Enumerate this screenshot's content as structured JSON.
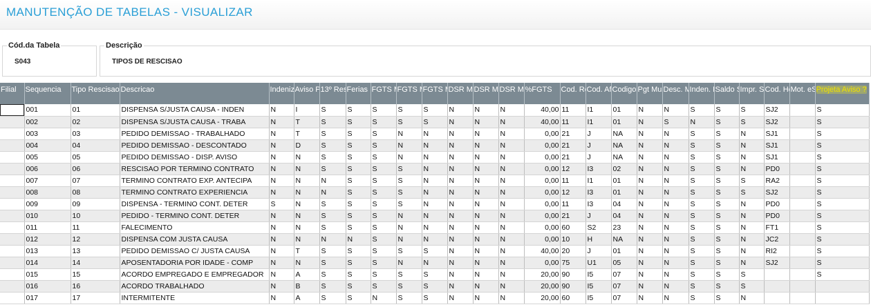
{
  "page": {
    "title": "MANUTENÇÃO DE TABELAS - VISUALIZAR"
  },
  "form": {
    "code_label": "Cód.da Tabela",
    "code_value": "S043",
    "desc_label": "Descrição",
    "desc_value": "TIPOS DE RESCISAO"
  },
  "grid": {
    "highlight_color": "#f0e000",
    "header_bg": "#7c8a93",
    "columns": [
      "Filial",
      "Sequencia",
      "Tipo Rescisao",
      "Descricao",
      "Indenizacao",
      "Aviso P",
      "13º Res",
      "Ferias",
      "FGTS M",
      "FGTS M",
      "FGTS M",
      "DSR Me",
      "DSR Me",
      "DSR Me",
      "%FGTS",
      "Cod. Re",
      "Cod. Af",
      "Codigo",
      "Pgt Mul",
      "Desc. M",
      "Inden. E",
      "Saldo S",
      "Impr. Sa",
      "Cod. Ho",
      "Mot. eS",
      "Projeta Aviso ?"
    ],
    "rows": [
      [
        "",
        "001",
        "01",
        "DISPENSA S/JUSTA CAUSA - INDEN",
        "N",
        "I",
        "S",
        "S",
        "S",
        "S",
        "S",
        "N",
        "N",
        "N",
        "40,00",
        "11",
        "I1",
        "01",
        "N",
        "N",
        "S",
        "S",
        "S",
        "SJ2",
        "",
        "S"
      ],
      [
        "",
        "002",
        "02",
        "DISPENSA S/JUSTA CAUSA - TRABA",
        "N",
        "T",
        "S",
        "S",
        "S",
        "S",
        "S",
        "N",
        "N",
        "N",
        "40,00",
        "11",
        "I1",
        "01",
        "N",
        "S",
        "N",
        "S",
        "S",
        "SJ2",
        "",
        "S"
      ],
      [
        "",
        "003",
        "03",
        "PEDIDO DEMISSAO - TRABALHADO",
        "N",
        "T",
        "S",
        "S",
        "S",
        "N",
        "N",
        "N",
        "N",
        "N",
        "0,00",
        "21",
        "J",
        "NA",
        "N",
        "N",
        "S",
        "S",
        "N",
        "SJ1",
        "",
        "S"
      ],
      [
        "",
        "004",
        "04",
        "PEDIDO DEMISSAO - DESCONTADO",
        "N",
        "D",
        "S",
        "S",
        "S",
        "N",
        "N",
        "N",
        "N",
        "N",
        "0,00",
        "21",
        "J",
        "NA",
        "N",
        "N",
        "S",
        "S",
        "N",
        "SJ1",
        "",
        "S"
      ],
      [
        "",
        "005",
        "05",
        "PEDIDO DEMISSAO - DISP. AVISO",
        "N",
        "N",
        "S",
        "S",
        "S",
        "N",
        "N",
        "N",
        "N",
        "N",
        "0,00",
        "21",
        "J",
        "NA",
        "N",
        "N",
        "S",
        "S",
        "N",
        "SJ1",
        "",
        "S"
      ],
      [
        "",
        "006",
        "06",
        "RESCISAO POR TERMINO CONTRATO",
        "N",
        "N",
        "S",
        "S",
        "S",
        "S",
        "N",
        "N",
        "N",
        "N",
        "0,00",
        "12",
        "I3",
        "02",
        "N",
        "N",
        "S",
        "S",
        "N",
        "PD0",
        "",
        "S"
      ],
      [
        "",
        "007",
        "07",
        "TERMINO CONTRATO EXP. ANTECIPA",
        "N",
        "N",
        "N",
        "S",
        "S",
        "S",
        "N",
        "N",
        "N",
        "N",
        "0,00",
        "11",
        "I1",
        "01",
        "N",
        "N",
        "S",
        "S",
        "S",
        "RA2",
        "",
        "S"
      ],
      [
        "",
        "008",
        "08",
        "TERMINO CONTRATO EXPERIENCIA",
        "N",
        "N",
        "N",
        "S",
        "S",
        "S",
        "N",
        "N",
        "N",
        "N",
        "0,00",
        "12",
        "I3",
        "01",
        "N",
        "N",
        "S",
        "S",
        "S",
        "SJ2",
        "",
        "S"
      ],
      [
        "",
        "009",
        "09",
        "DISPENSA - TERMINO CONT. DETER",
        "S",
        "N",
        "S",
        "S",
        "S",
        "S",
        "N",
        "N",
        "N",
        "N",
        "0,00",
        "11",
        "I3",
        "04",
        "N",
        "N",
        "S",
        "S",
        "N",
        "PD0",
        "",
        "S"
      ],
      [
        "",
        "010",
        "10",
        "PEDIDO - TERMINO CONT. DETER",
        "N",
        "N",
        "S",
        "S",
        "S",
        "N",
        "N",
        "N",
        "N",
        "N",
        "0,00",
        "21",
        "J",
        "04",
        "N",
        "N",
        "S",
        "S",
        "N",
        "PD0",
        "",
        "S"
      ],
      [
        "",
        "011",
        "11",
        "FALECIMENTO",
        "N",
        "N",
        "S",
        "S",
        "S",
        "N",
        "N",
        "N",
        "N",
        "N",
        "0,00",
        "60",
        "S2",
        "23",
        "N",
        "N",
        "S",
        "S",
        "N",
        "FT1",
        "",
        "S"
      ],
      [
        "",
        "012",
        "12",
        "DISPENSA COM JUSTA CAUSA",
        "N",
        "N",
        "N",
        "N",
        "S",
        "N",
        "N",
        "N",
        "N",
        "N",
        "0,00",
        "10",
        "H",
        "NA",
        "N",
        "N",
        "S",
        "S",
        "N",
        "JC2",
        "",
        "S"
      ],
      [
        "",
        "013",
        "13",
        "PEDIDO DEMISSAO C/ JUSTA CAUSA",
        "N",
        "T",
        "S",
        "S",
        "S",
        "S",
        "S",
        "N",
        "N",
        "N",
        "40,00",
        "20",
        "J",
        "01",
        "N",
        "N",
        "S",
        "S",
        "N",
        "RI2",
        "",
        "S"
      ],
      [
        "",
        "014",
        "14",
        "APOSENTADORIA POR IDADE - COMP",
        "N",
        "N",
        "S",
        "S",
        "S",
        "N",
        "N",
        "N",
        "N",
        "N",
        "0,00",
        "75",
        "U1",
        "05",
        "N",
        "N",
        "S",
        "S",
        "N",
        "SJ2",
        "",
        "S"
      ],
      [
        "",
        "015",
        "15",
        "ACORDO EMPREGADO E EMPREGADOR",
        "N",
        "A",
        "S",
        "S",
        "S",
        "S",
        "S",
        "N",
        "N",
        "N",
        "20,00",
        "90",
        "I5",
        "07",
        "N",
        "N",
        "S",
        "S",
        "S",
        "",
        "",
        "S"
      ],
      [
        "",
        "016",
        "16",
        "ACORDO TRABALHADO",
        "N",
        "B",
        "S",
        "S",
        "S",
        "S",
        "S",
        "N",
        "N",
        "N",
        "20,00",
        "90",
        "I5",
        "07",
        "N",
        "N",
        "S",
        "S",
        "S",
        "",
        "",
        ""
      ],
      [
        "",
        "017",
        "17",
        "INTERMITENTE",
        "N",
        "A",
        "S",
        "S",
        "N",
        "S",
        "S",
        "N",
        "N",
        "N",
        "20,00",
        "60",
        "I5",
        "07",
        "N",
        "N",
        "S",
        "S",
        "N",
        "",
        "",
        ""
      ]
    ]
  }
}
